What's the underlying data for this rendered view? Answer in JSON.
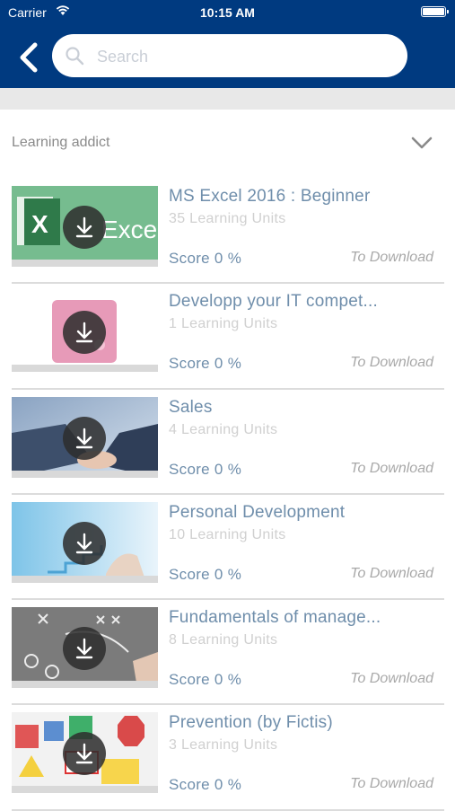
{
  "status_bar": {
    "carrier": "Carrier",
    "time": "10:15 AM"
  },
  "search": {
    "placeholder": "Search"
  },
  "section": {
    "title": "Learning addict"
  },
  "items": [
    {
      "title": "MS Excel 2016 : Beginner",
      "units": "35 Learning Units",
      "score": "Score 0 %",
      "status": "To Download",
      "thumb": "excel"
    },
    {
      "title": "Developp your IT compet...",
      "units": "1 Learning Units",
      "score": "Score 0 %",
      "status": "To Download",
      "thumb": "it"
    },
    {
      "title": "Sales",
      "units": "4 Learning Units",
      "score": "Score 0 %",
      "status": "To Download",
      "thumb": "sales"
    },
    {
      "title": "Personal Development",
      "units": "10 Learning Units",
      "score": "Score 0 %",
      "status": "To Download",
      "thumb": "personal"
    },
    {
      "title": "Fundamentals of manage...",
      "units": "8 Learning Units",
      "score": "Score 0 %",
      "status": "To Download",
      "thumb": "manage"
    },
    {
      "title": "Prevention (by Fictis)",
      "units": "3 Learning Units",
      "score": "Score 0 %",
      "status": "To Download",
      "thumb": "prevention"
    }
  ],
  "colors": {
    "header": "#003a80",
    "title": "#6f8eab",
    "units": "#d0d0d0",
    "status": "#a8a8a8"
  }
}
